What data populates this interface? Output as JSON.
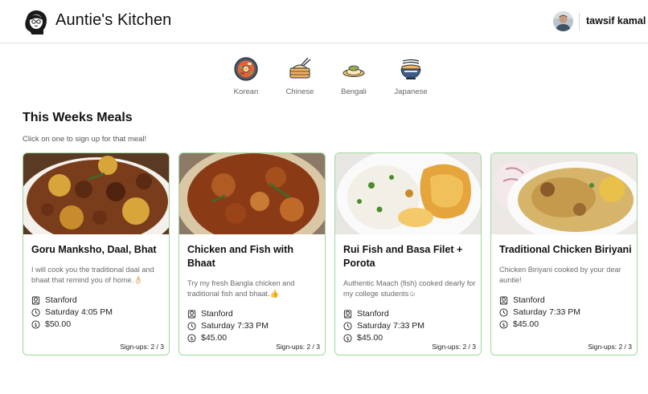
{
  "header": {
    "brand": "Auntie's Kitchen",
    "user": {
      "name": "tawsif kamal"
    }
  },
  "cuisines": [
    {
      "label": "Korean",
      "icon": "korean-food-icon"
    },
    {
      "label": "Chinese",
      "icon": "chinese-food-icon"
    },
    {
      "label": "Bengali",
      "icon": "bengali-food-icon"
    },
    {
      "label": "Japanese",
      "icon": "japanese-food-icon"
    }
  ],
  "section": {
    "title": "This Weeks Meals",
    "subtitle": "Click on one to sign up for that meal!"
  },
  "meals": [
    {
      "title": "Goru Manksho, Daal, Bhat",
      "description": "I will cook you the traditional daal and bhaat that remind you of home.👌🏻",
      "location": "Stanford",
      "time": "Saturday 4:05 PM",
      "price": "$50.00",
      "signups": "Sign-ups: 2 / 3"
    },
    {
      "title": "Chicken and Fish with Bhaat",
      "description": "Try my fresh Bangla chicken and traditional fish and bhaat.👍",
      "location": "Stanford",
      "time": "Saturday 7:33 PM",
      "price": "$45.00",
      "signups": "Sign-ups: 2 / 3"
    },
    {
      "title": "Rui Fish and Basa Filet + Porota",
      "description": "Authentic Maach (fish) cooked dearly for my college students☺",
      "location": "Stanford",
      "time": "Saturday 7:33 PM",
      "price": "$45.00",
      "signups": "Sign-ups: 2 / 3"
    },
    {
      "title": "Traditional Chicken Biriyani",
      "description": "Chicken Biriyani cooked by your dear auntie!",
      "location": "Stanford",
      "time": "Saturday 7:33 PM",
      "price": "$45.00",
      "signups": "Sign-ups: 2 / 3"
    }
  ],
  "colors": {
    "card_border": "#9fd79f",
    "text": "#111111",
    "muted": "#6b6b6b"
  }
}
